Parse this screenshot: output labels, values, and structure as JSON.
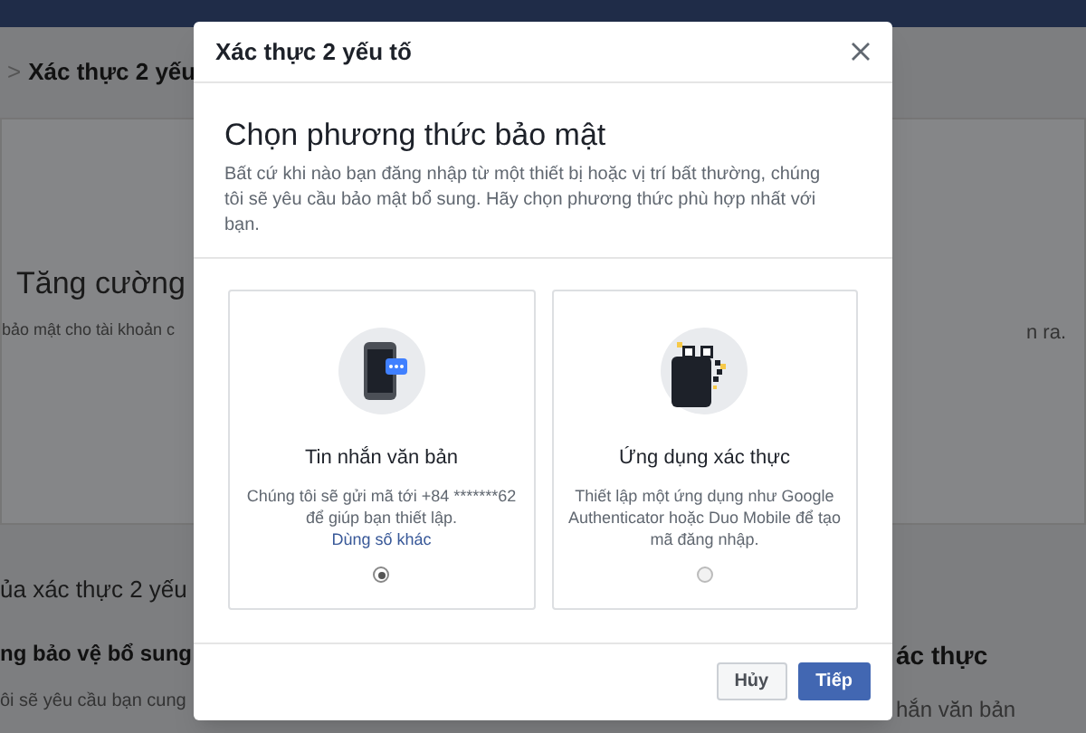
{
  "background": {
    "breadcrumb_arrow": ">",
    "breadcrumb": "Xác thực 2 yếu",
    "heading": "Tăng cường",
    "subtext_left": "bảo mật cho tài khoản c",
    "subtext_right": "n ra.",
    "section_title": "ủa xác thực 2 yếu",
    "left_heading": "ng bảo vệ bổ sung",
    "left_text": "ôi sẽ yêu cầu bạn cung",
    "right_heading": "ác thực",
    "right_text": "hắn văn bản"
  },
  "dialog": {
    "title": "Xác thực 2 yếu tố",
    "heading": "Chọn phương thức bảo mật",
    "description": "Bất cứ khi nào bạn đăng nhập từ một thiết bị hoặc vị trí bất thường, chúng tôi sẽ yêu cầu bảo mật bổ sung. Hãy chọn phương thức phù hợp nhất với bạn.",
    "options": [
      {
        "kind": "sms",
        "title": "Tin nhắn văn bản",
        "description": "Chúng tôi sẽ gửi mã tới +84 *******62 để giúp bạn thiết lập.",
        "link": "Dùng số khác",
        "selected": true
      },
      {
        "kind": "app",
        "title": "Ứng dụng xác thực",
        "description": "Thiết lập một ứng dụng như Google Authenticator hoặc Duo Mobile để tạo mã đăng nhập.",
        "selected": false
      }
    ],
    "buttons": [
      {
        "kind": "secondary",
        "label": "Hủy"
      },
      {
        "kind": "primary",
        "label": "Tiếp"
      }
    ]
  }
}
